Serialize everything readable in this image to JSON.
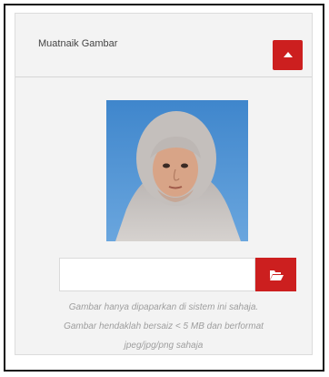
{
  "panel": {
    "title": "Muatnaik Gambar",
    "collapse_icon": "caret-up-icon",
    "accent_color": "#cc1f1f"
  },
  "photo": {
    "subject": "profile-photo",
    "background_color": "#4f8fcf"
  },
  "upload": {
    "value": "",
    "placeholder": "",
    "browse_icon": "folder-open-icon"
  },
  "help": {
    "line1": "Gambar hanya dipaparkan di sistem ini sahaja.",
    "line2": "Gambar hendaklah bersaiz < 5 MB dan berformat",
    "line3": "jpeg/jpg/png sahaja"
  }
}
